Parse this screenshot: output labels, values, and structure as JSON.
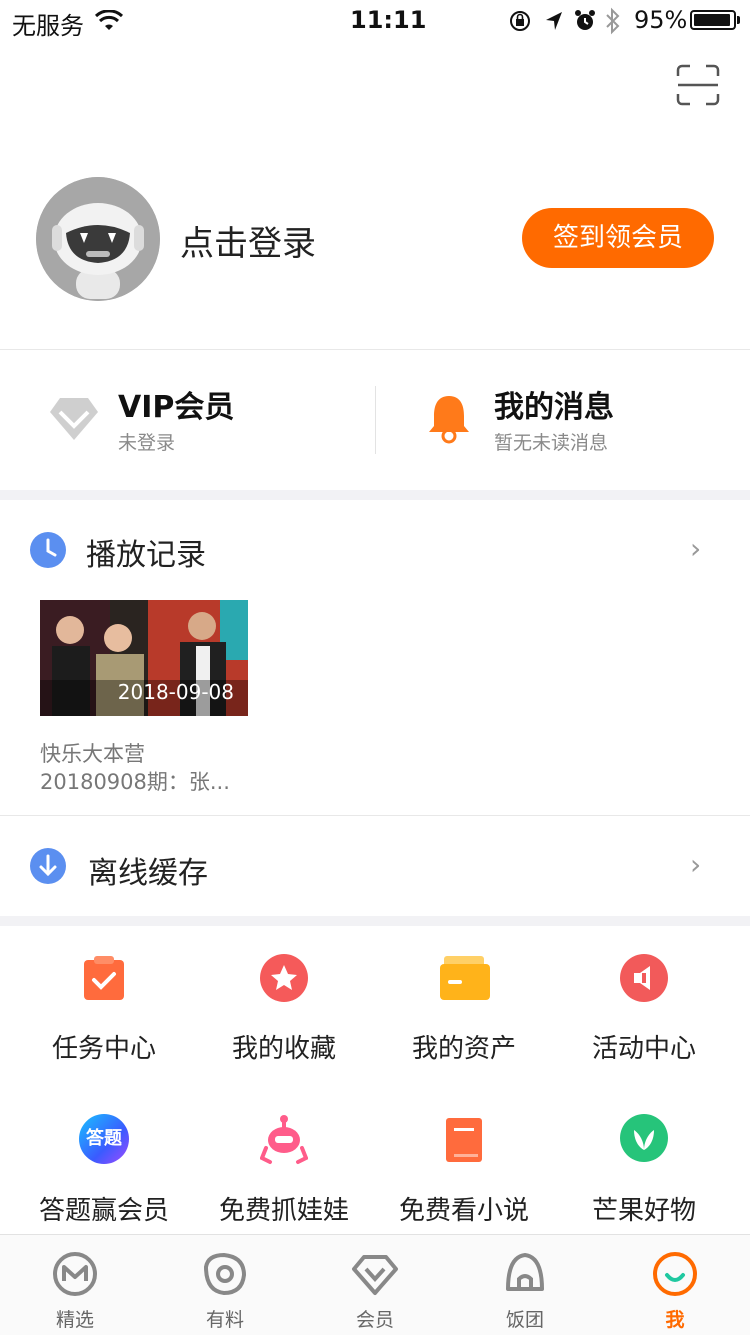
{
  "status_bar": {
    "carrier": "无服务",
    "time": "11:11",
    "battery": "95%",
    "battery_level": 0.95
  },
  "profile": {
    "login_label": "点击登录",
    "signin_button": "签到领会员"
  },
  "vip": {
    "title": "VIP会员",
    "subtitle": "未登录"
  },
  "messages": {
    "title": "我的消息",
    "subtitle": "暂无未读消息"
  },
  "history": {
    "title": "播放记录",
    "item": {
      "date": "2018-09-08",
      "title_line1": "快乐大本营",
      "title_line2": "20180908期：张..."
    }
  },
  "offline": {
    "title": "离线缓存"
  },
  "grid": [
    {
      "label": "任务中心",
      "icon": "task-clipboard-icon",
      "color": "#ff6b3d"
    },
    {
      "label": "我的收藏",
      "icon": "star-icon",
      "color": "#f55a5a"
    },
    {
      "label": "我的资产",
      "icon": "wallet-icon",
      "color": "#ffb31a"
    },
    {
      "label": "活动中心",
      "icon": "megaphone-icon",
      "color": "#f25a5a"
    },
    {
      "label": "答题赢会员",
      "icon": "quiz-icon",
      "color": "#3a7bff"
    },
    {
      "label": "免费抓娃娃",
      "icon": "claw-machine-icon",
      "color": "#ff5c8a"
    },
    {
      "label": "免费看小说",
      "icon": "book-icon",
      "color": "#ff6b3d"
    },
    {
      "label": "芒果好物",
      "icon": "leaf-icon",
      "color": "#26c47a"
    }
  ],
  "quiz_badge_text": "答题",
  "tabs": [
    {
      "label": "精选",
      "icon": "mango-m-icon"
    },
    {
      "label": "有料",
      "icon": "eye-icon"
    },
    {
      "label": "会员",
      "icon": "diamond-icon"
    },
    {
      "label": "饭团",
      "icon": "rice-ball-icon"
    },
    {
      "label": "我",
      "icon": "smile-circle-icon"
    }
  ],
  "colors": {
    "accent": "#ff6a00",
    "active_tab": "#ff6a00",
    "blue_icon": "#5b8ff0"
  }
}
